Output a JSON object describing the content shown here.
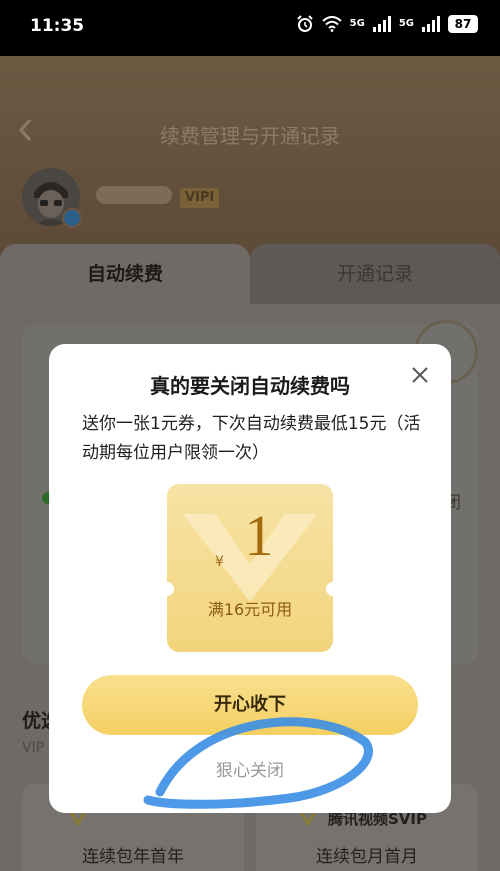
{
  "status_bar": {
    "time": "11:35",
    "network_1": "5G",
    "network_2": "5G",
    "battery": "87"
  },
  "header": {
    "title": "续费管理与开通记录",
    "vip_badge": "VIPⅠ"
  },
  "tabs": [
    {
      "label": "自动续费",
      "active": true
    },
    {
      "label": "开通记录",
      "active": false
    }
  ],
  "offers": {
    "title": "优选",
    "subtitle": "VIP",
    "right_brand": "腾讯视频SVIP",
    "cards": [
      {
        "label": "连续包年首年"
      },
      {
        "label": "连续包月首月"
      }
    ]
  },
  "modal": {
    "title": "真的要关闭自动续费吗",
    "description": "送你一张1元券，下次自动续费最低15元（活动期每位用户限领一次）",
    "coupon": {
      "currency": "¥",
      "amount": "1",
      "condition": "满16元可用"
    },
    "accept_label": "开心收下",
    "decline_label": "狠心关闭"
  },
  "colors": {
    "accent_gold": "#f4cf62",
    "coupon_text": "#a56a0e",
    "annotation_blue": "#3a8ee6"
  }
}
